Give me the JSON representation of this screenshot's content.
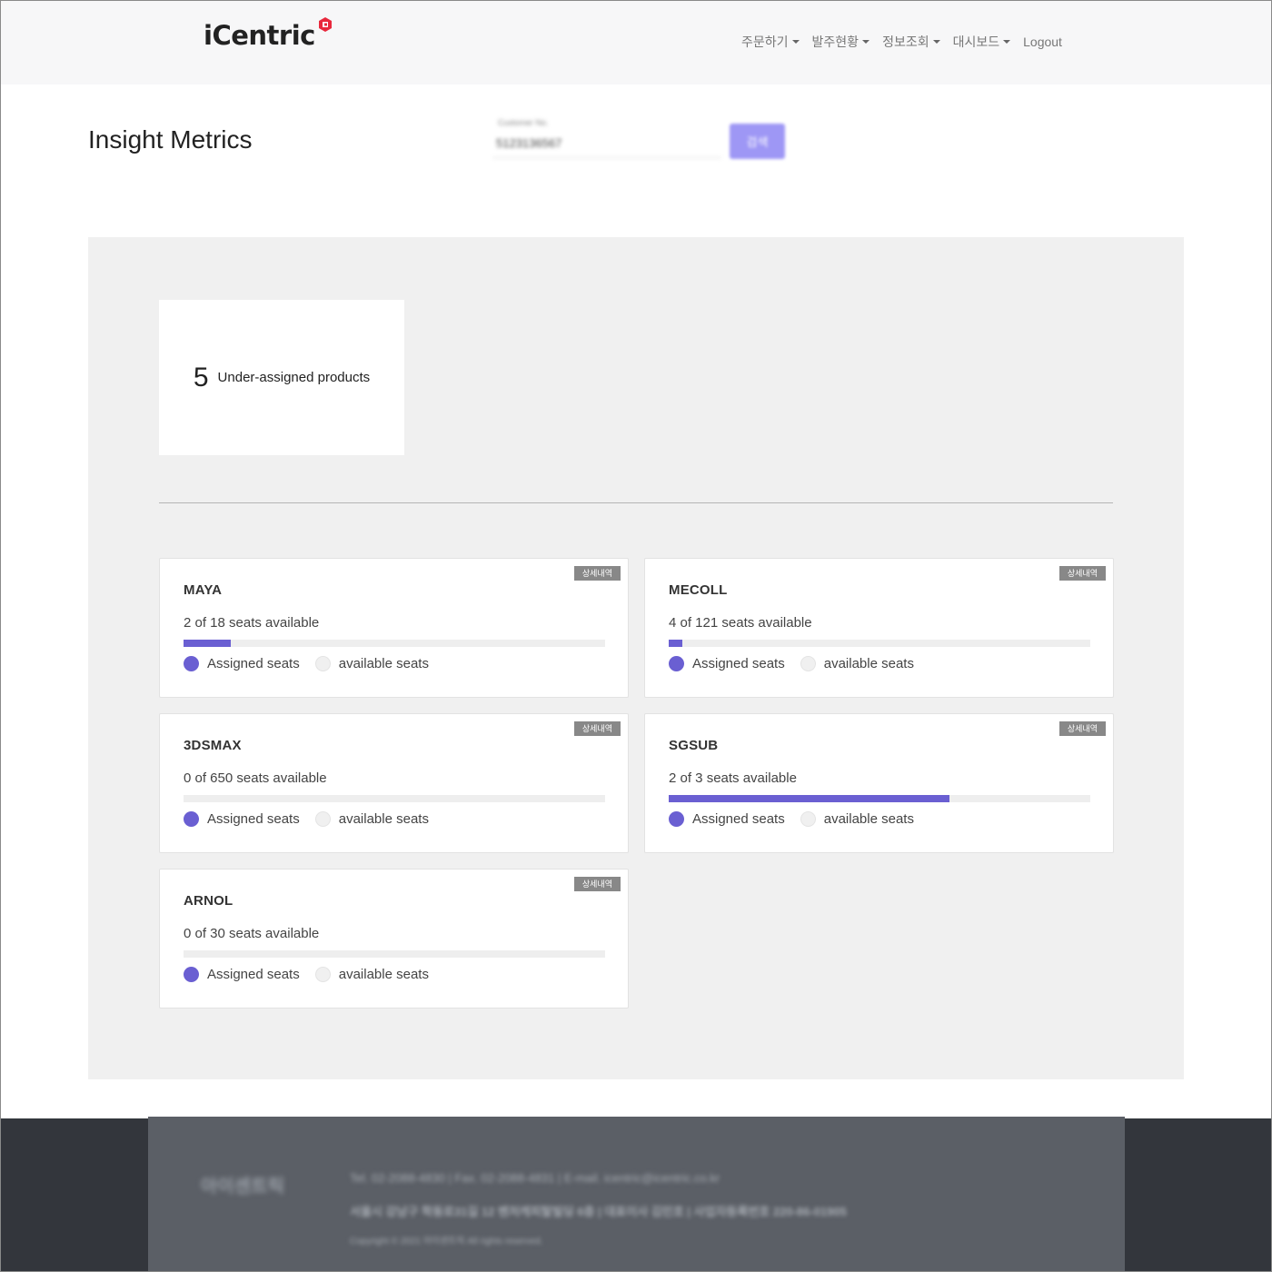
{
  "header": {
    "logo_text": "iCentric",
    "nav": [
      {
        "label": "주문하기"
      },
      {
        "label": "발주현황"
      },
      {
        "label": "정보조회"
      },
      {
        "label": "대시보드"
      }
    ],
    "logout_label": "Logout"
  },
  "page": {
    "title": "Insight Metrics",
    "search": {
      "label": "Customer No.",
      "value": "5123136567",
      "button_label": "검색"
    }
  },
  "summary": {
    "count": "5",
    "label": "Under-assigned products"
  },
  "legend": {
    "assigned": "Assigned seats",
    "available": "available seats"
  },
  "detail_label": "상세내역",
  "products": [
    {
      "name": "MAYA",
      "seats_text": "2 of 18 seats available",
      "assigned_fraction": 0.111
    },
    {
      "name": "MECOLL",
      "seats_text": "4 of 121 seats available",
      "assigned_fraction": 0.033
    },
    {
      "name": "3DSMAX",
      "seats_text": "0 of 650 seats available",
      "assigned_fraction": 0.0
    },
    {
      "name": "SGSUB",
      "seats_text": "2 of 3 seats available",
      "assigned_fraction": 0.667
    },
    {
      "name": "ARNOL",
      "seats_text": "0 of 30 seats available",
      "assigned_fraction": 0.0
    }
  ],
  "footer": {
    "brand": "아이센트릭",
    "line1": "Tel. 02-2088-4830  |  Fax. 02-2088-4831  |  E-mail. icentric@icentric.co.kr",
    "line2": "서울시 강남구 학동로31길 12 벤처캐피탈빌딩 6층  |  대표이사 김민호  |  사업자등록번호 220-86-01905",
    "line3": "Copyright © 2021 아이센트릭 All rights reserved."
  },
  "colors": {
    "accent": "#6a5fd2",
    "search_button": "#9e97f5",
    "panel_bg": "#f0f0f0",
    "footer_bg": "#33363c"
  }
}
